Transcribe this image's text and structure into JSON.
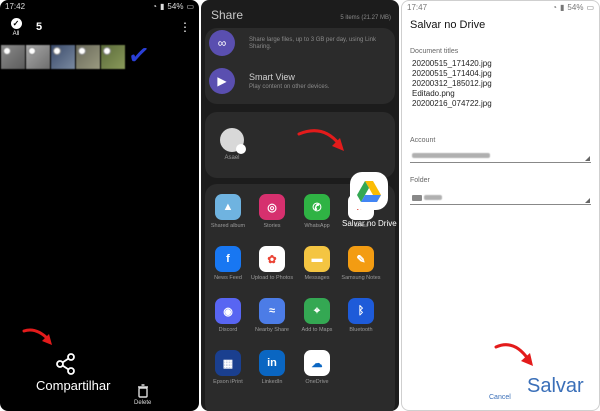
{
  "panel1": {
    "status_time": "17:42",
    "status_battery": "54%",
    "select_all_label": "All",
    "selected_count": "5",
    "share_label": "Compartilhar",
    "delete_label": "Delete"
  },
  "panel2": {
    "title": "Share",
    "summary": "5 items (21.27 MB)",
    "link_sharing_text": "Share large files, up to 3 GB per day, using Link Sharing.",
    "smart_view_label": "Smart View",
    "smart_view_desc": "Play content on other devices.",
    "contact_name": "Asael",
    "drive_label": "Salvar no Drive",
    "apps": [
      {
        "label": "Shared album",
        "icon": "shared-album-icon",
        "color": "#6fb3e0"
      },
      {
        "label": "Stories",
        "icon": "instagram-icon",
        "color": "#d6306e"
      },
      {
        "label": "WhatsApp",
        "icon": "whatsapp-icon",
        "color": "#2fb344"
      },
      {
        "label": "Gmail",
        "icon": "gmail-icon",
        "color": "#ffffff"
      },
      {
        "label": "News Feed",
        "icon": "facebook-icon",
        "color": "#1877f2"
      },
      {
        "label": "Upload to Photos",
        "icon": "google-photos-icon",
        "color": "#ffffff"
      },
      {
        "label": "Messages",
        "icon": "messages-icon",
        "color": "#f4c542"
      },
      {
        "label": "Samsung Notes",
        "icon": "samsung-notes-icon",
        "color": "#f39c12"
      },
      {
        "label": "Discord",
        "icon": "discord-icon",
        "color": "#5865f2"
      },
      {
        "label": "Nearby Share",
        "icon": "nearby-share-icon",
        "color": "#4c7ce6"
      },
      {
        "label": "Add to Maps",
        "icon": "maps-icon",
        "color": "#34a853"
      },
      {
        "label": "Bluetooth",
        "icon": "bluetooth-icon",
        "color": "#1e5bd9"
      },
      {
        "label": "Epson iPrint",
        "icon": "epson-icon",
        "color": "#1a3f8f"
      },
      {
        "label": "LinkedIn",
        "icon": "linkedin-icon",
        "color": "#0a66c2"
      },
      {
        "label": "OneDrive",
        "icon": "onedrive-icon",
        "color": "#ffffff"
      }
    ]
  },
  "panel3": {
    "status_time": "17:47",
    "status_battery": "54%",
    "title": "Salvar no Drive",
    "doc_titles_label": "Document titles",
    "files": [
      "20200515_171420.jpg",
      "20200515_171404.jpg",
      "20200312_185012.jpg",
      "Editado.png",
      "20200216_074722.jpg"
    ],
    "account_label": "Account",
    "folder_label": "Folder",
    "cancel_label": "Cancel",
    "save_label": "Salvar"
  }
}
